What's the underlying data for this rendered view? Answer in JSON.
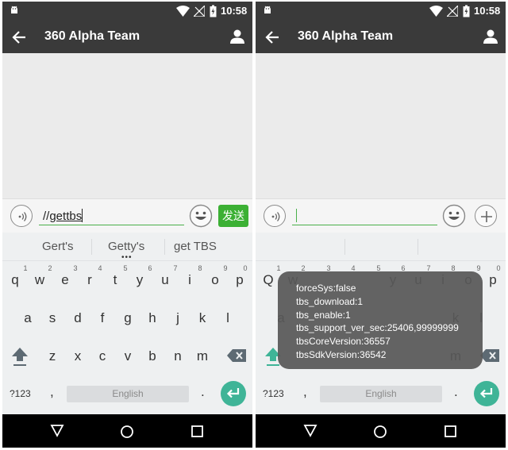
{
  "status": {
    "time": "10:58"
  },
  "header": {
    "title": "360 Alpha Team"
  },
  "input": {
    "left_prefix": "//",
    "left_text": "gettbs",
    "send_label": "发送"
  },
  "suggestions": [
    "Gert's",
    "Getty's",
    "get TBS"
  ],
  "keyboard": {
    "row1": [
      "q",
      "w",
      "e",
      "r",
      "t",
      "y",
      "u",
      "i",
      "o",
      "p"
    ],
    "row1_hints": [
      "1",
      "2",
      "3",
      "4",
      "5",
      "6",
      "7",
      "8",
      "9",
      "0"
    ],
    "row2": [
      "a",
      "s",
      "d",
      "f",
      "g",
      "h",
      "j",
      "k",
      "l"
    ],
    "row3": [
      "z",
      "x",
      "c",
      "v",
      "b",
      "n",
      "m"
    ],
    "symbols_label": "?123",
    "comma": ",",
    "period": ".",
    "space_label": "English",
    "right_row1_first": "Q"
  },
  "toast": {
    "lines": [
      "forceSys:false",
      "tbs_download:1",
      "tbs_enable:1",
      "tbs_support_ver_sec:25406,99999999",
      "tbsCoreVersion:36557",
      "tbsSdkVersion:36542"
    ]
  },
  "colors": {
    "bar": "#3a3a3a",
    "send": "#3cb034",
    "enter": "#3fb497",
    "shift": "#3fb497"
  }
}
